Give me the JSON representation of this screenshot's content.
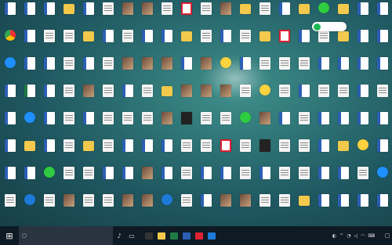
{
  "desktop": {
    "icon_label": "",
    "spotify_label": "",
    "icons": [
      "doc",
      "doc",
      "doc",
      "folder",
      "doc",
      "docx",
      "img",
      "img",
      "docx",
      "red",
      "docx",
      "img",
      "folder",
      "docx",
      "doc",
      "folder",
      "green",
      "folder",
      "doc",
      "doc",
      "chrome",
      "doc",
      "docx",
      "docx",
      "folder",
      "doc",
      "docx",
      "doc",
      "doc",
      "folder",
      "docx",
      "doc",
      "docx",
      "folder",
      "red",
      "doc",
      "docx",
      "folder",
      "doc",
      "doc",
      "blue",
      "doc",
      "doc",
      "docx",
      "doc",
      "docx",
      "img",
      "img",
      "img",
      "doc",
      "img",
      "emoji",
      "doc",
      "docx",
      "docx",
      "docx",
      "doc",
      "doc",
      "doc",
      "doc",
      "doc",
      "xls",
      "doc",
      "docx",
      "img",
      "docx",
      "doc",
      "docx",
      "folder",
      "img",
      "img",
      "img",
      "docx",
      "emoji",
      "docx",
      "doc",
      "docx",
      "docx",
      "doc",
      "docx",
      "doc",
      "blue",
      "doc",
      "docx",
      "doc",
      "docx",
      "docx",
      "docx",
      "img",
      "dark",
      "docx",
      "docx",
      "green",
      "img",
      "doc",
      "docx",
      "doc",
      "doc",
      "doc",
      "doc",
      "doc",
      "folder",
      "doc",
      "docx",
      "folder",
      "docx",
      "doc",
      "doc",
      "doc",
      "docx",
      "docx",
      "red",
      "docx",
      "dark",
      "docx",
      "docx",
      "doc",
      "folder",
      "emoji",
      "doc",
      "doc",
      "doc",
      "green",
      "docx",
      "docx",
      "doc",
      "doc",
      "img",
      "doc",
      "docx",
      "doc",
      "doc",
      "docx",
      "doc",
      "docx",
      "docx",
      "doc",
      "doc",
      "docx",
      "blue",
      "docx",
      "edge",
      "docx",
      "img",
      "docx",
      "docx",
      "img",
      "img",
      "edge",
      "docx",
      "doc",
      "img",
      "img",
      "docx",
      "docx",
      "folder",
      "doc",
      "doc",
      "doc",
      "doc"
    ]
  },
  "taskbar": {
    "search_placeholder": "",
    "clock_time": "",
    "clock_date": "",
    "pinned": [
      "#333",
      "#f2c94c",
      "#1f7a44",
      "#2b5fb4",
      "#d23",
      "#1d7ad8"
    ]
  }
}
